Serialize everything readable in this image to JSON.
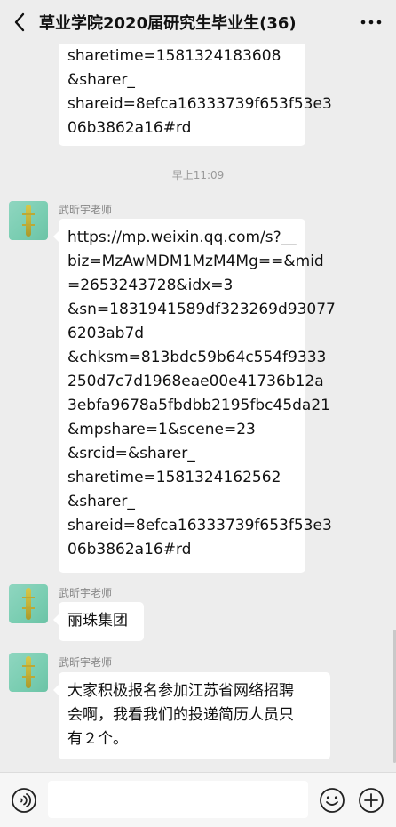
{
  "header": {
    "title": "草业学院2020届研究生毕业生(36)",
    "back_icon": "chevron-left-icon",
    "more_icon": "more-icon"
  },
  "messages": {
    "msg0_text": "sharetime=1581324183608\n&sharer_\nshareid=8efca16333739f653f53e3\n06b3862a16#rd",
    "timestamp": "早上11:09",
    "msg1_sender": "武昕宇老师",
    "msg1_text": "https://mp.weixin.qq.com/s?__\nbiz=MzAwMDM1MzM4Mg==&mid\n=2653243728&idx=3\n&sn=1831941589df323269d93077\n6203ab7d\n&chksm=813bdc59b64c554f9333\n250d7c7d1968eae00e41736b12a\n3ebfa9678a5fbdbb2195fbc45da21\n&mpshare=1&scene=23\n&srcid=&sharer_\nsharetime=1581324162562\n&sharer_\nshareid=8efca16333739f653f53e3\n06b3862a16#rd",
    "msg2_sender": "武昕宇老师",
    "msg2_text": "丽珠集团",
    "msg3_sender": "武昕宇老师",
    "msg3_text": "大家积极报名参加江苏省网络招聘\n会啊，我看我们的投递简历人员只\n有２个。"
  },
  "input_bar": {
    "placeholder": "",
    "voice_icon": "voice-icon",
    "emoji_icon": "emoji-icon",
    "plus_icon": "plus-icon"
  },
  "colors": {
    "background": "#ededed",
    "bubble": "#ffffff",
    "text": "#111111",
    "meta_text": "#888888"
  }
}
